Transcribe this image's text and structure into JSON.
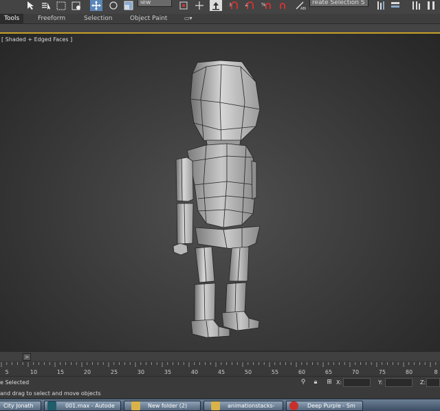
{
  "toolbar": {
    "view_dropdown": "iew",
    "selection_set_dropdown": "reate Selection S",
    "icons": [
      "select-icon",
      "select-by-name-icon",
      "rect-region-icon",
      "window-crossing-icon",
      "select-move-icon",
      "rotate-icon",
      "scale-icon",
      "ref-coord-icon",
      "pivot-icon",
      "select-manipulate-icon",
      "snap-toggle-icon",
      "angle-snap-icon",
      "percent-snap-icon",
      "spinner-snap-icon",
      "edit-named-sel-icon",
      "mirror-icon",
      "align-icon",
      "layer-icon",
      "curve-editor-icon"
    ]
  },
  "ribbon": {
    "tabs": [
      {
        "label": "Tools",
        "active": true
      },
      {
        "label": "Freeform",
        "active": false
      },
      {
        "label": "Selection",
        "active": false
      },
      {
        "label": "Object Paint",
        "active": false
      }
    ]
  },
  "viewport": {
    "label": "[ Shaded + Edged Faces ]"
  },
  "timeslider": {
    "handle_label": ">"
  },
  "trackbar": {
    "ticks": [
      "5",
      "10",
      "15",
      "20",
      "25",
      "30",
      "35",
      "40",
      "45",
      "50",
      "55",
      "60",
      "65",
      "70",
      "75",
      "80",
      "8"
    ]
  },
  "status": {
    "selection_text": "e Selected",
    "x_label": "X:",
    "y_label": "Y:",
    "z_label": "Z:"
  },
  "prompt": {
    "text": "and drag to select and move objects"
  },
  "taskbar": {
    "items": [
      {
        "label": "City Jonath",
        "icon_color": "#3b6fb6"
      },
      {
        "label": "001.max - Autode",
        "icon_color": "#1f5d6b"
      },
      {
        "label": "New folder (2)",
        "icon_color": "#d9b34a"
      },
      {
        "label": "animationstacks-",
        "icon_color": "#d9b34a"
      },
      {
        "label": "Deep Purple - Sm",
        "icon_color": "#c8302a"
      }
    ]
  },
  "colors": {
    "accent": "#c9a227",
    "viewport_bg": "#3d3d3d"
  }
}
